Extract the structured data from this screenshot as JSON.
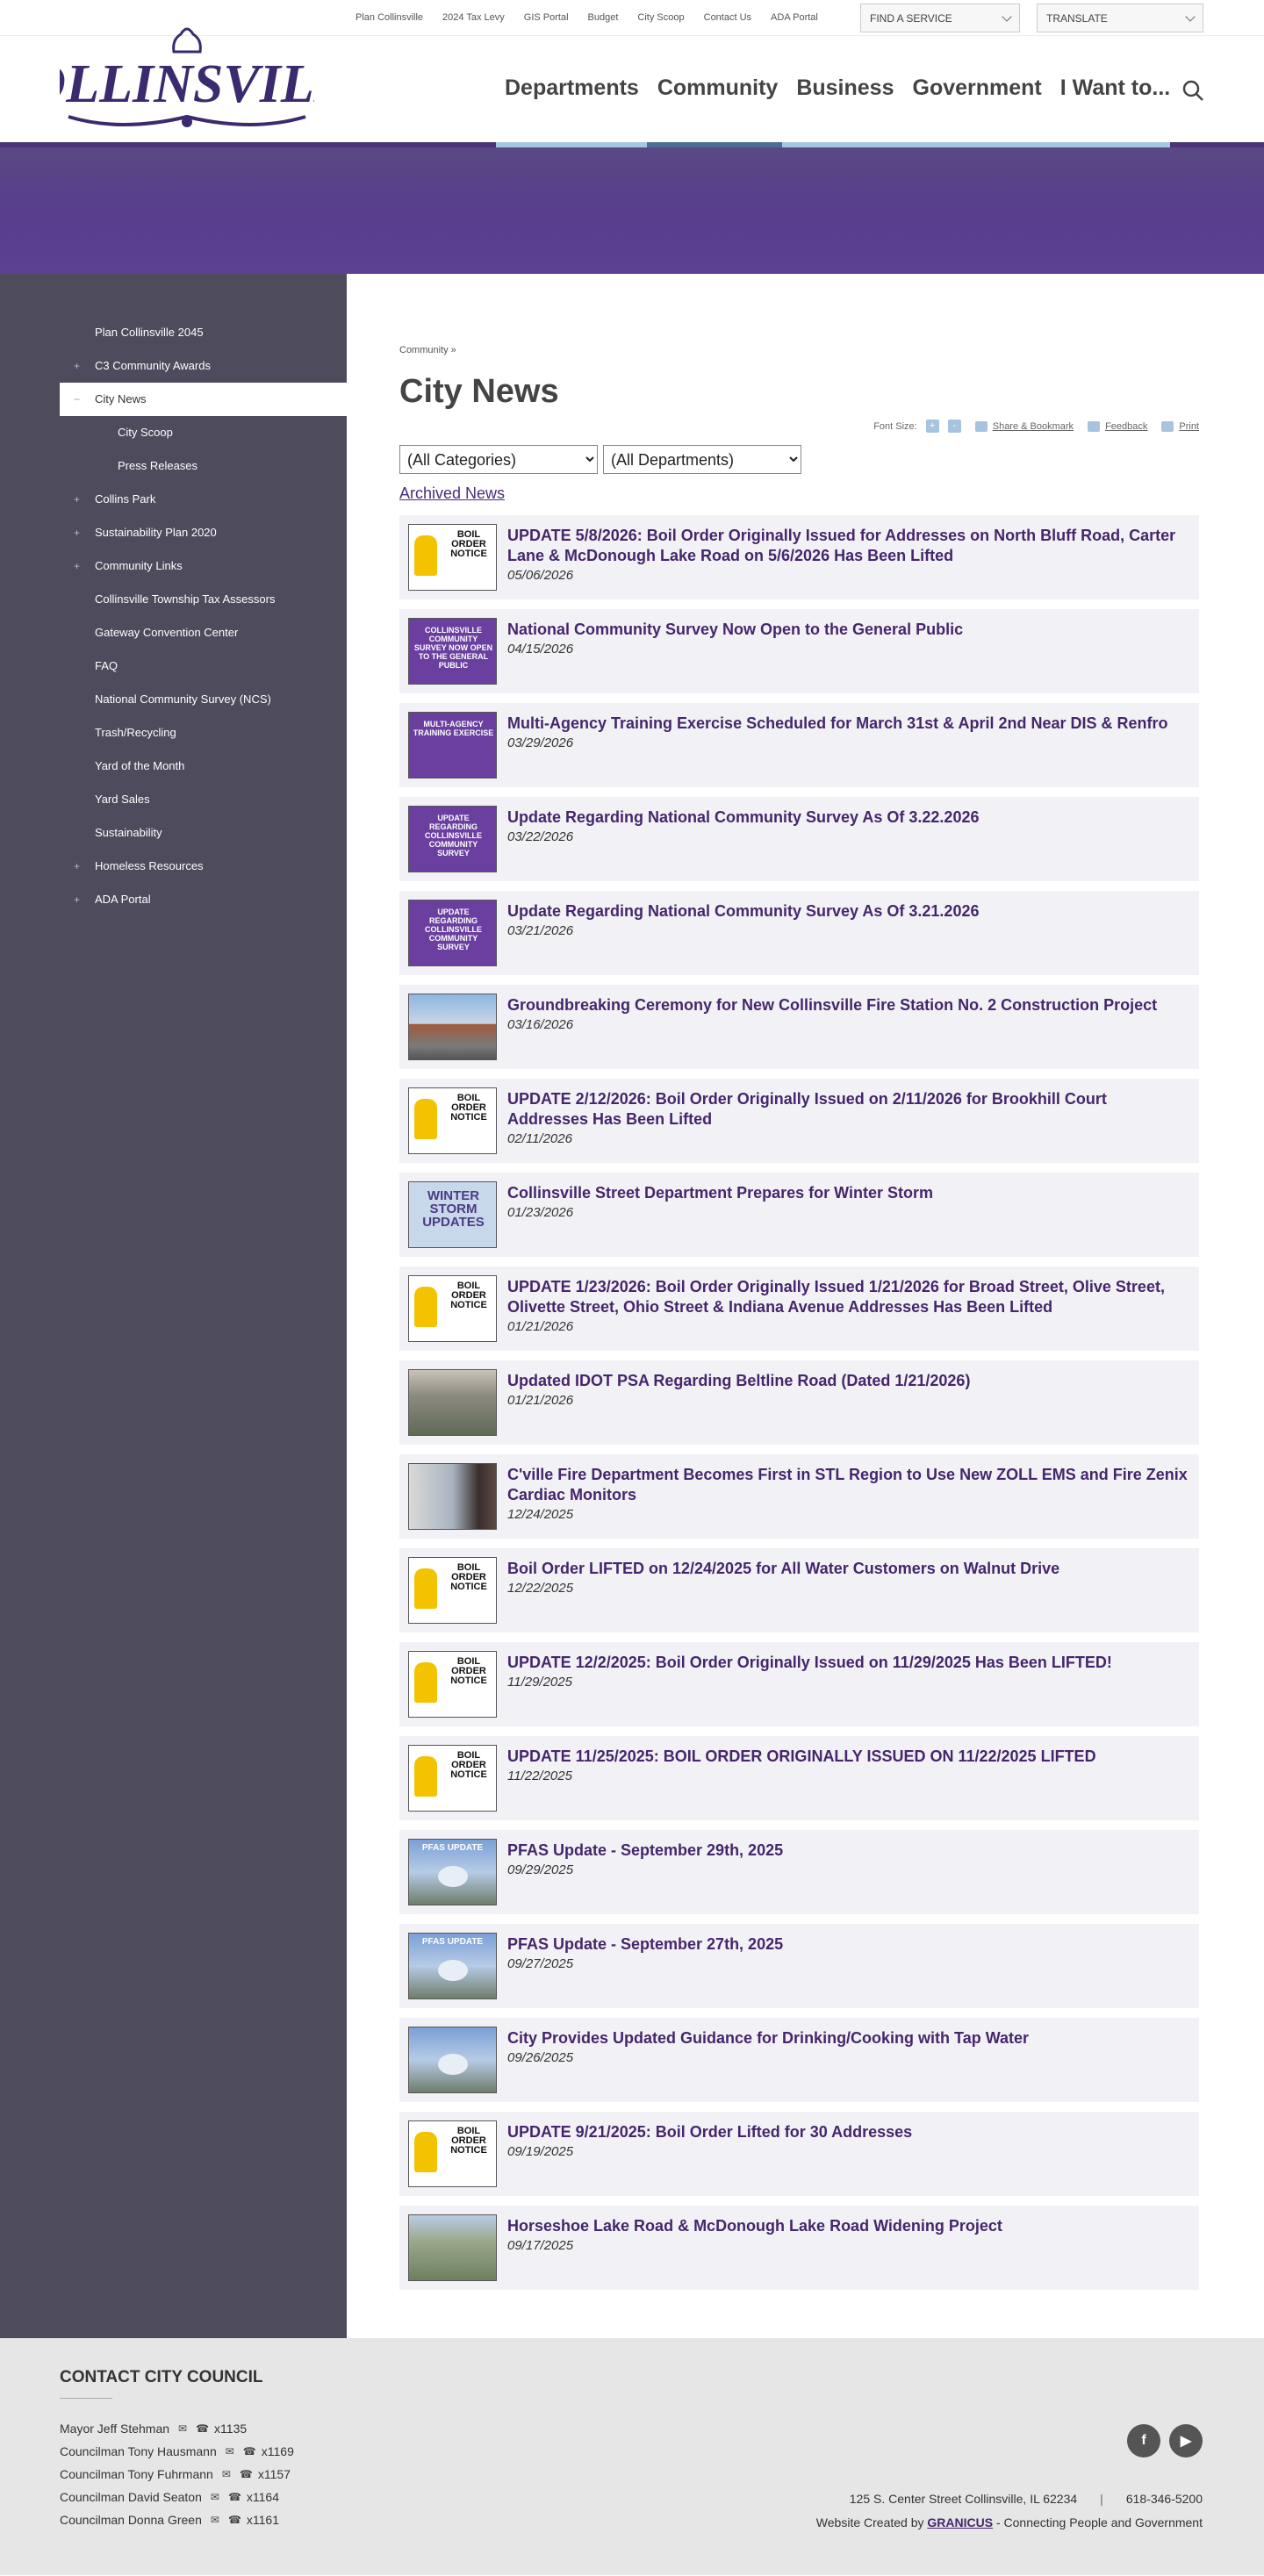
{
  "utility": {
    "links": [
      "Plan Collinsville",
      "2024 Tax Levy",
      "GIS Portal",
      "Budget",
      "City Scoop",
      "Contact Us",
      "ADA Portal"
    ],
    "find_service": "FIND A SERVICE",
    "translate": "TRANSLATE"
  },
  "logo": {
    "text": "COLLINSVILLE"
  },
  "nav": [
    "Departments",
    "Community",
    "Business",
    "Government",
    "I Want to..."
  ],
  "sidebar": [
    {
      "label": "Plan Collinsville 2045",
      "plus": ""
    },
    {
      "label": "C3 Community Awards",
      "plus": "+"
    },
    {
      "label": "City News",
      "plus": "−",
      "active": true
    },
    {
      "label": "City Scoop",
      "plus": "",
      "sub": true
    },
    {
      "label": "Press Releases",
      "plus": "",
      "sub": true
    },
    {
      "label": "Collins Park",
      "plus": "+"
    },
    {
      "label": "Sustainability Plan 2020",
      "plus": "+"
    },
    {
      "label": "Community Links",
      "plus": "+"
    },
    {
      "label": "Collinsville Township Tax Assessors",
      "plus": ""
    },
    {
      "label": "Gateway Convention Center",
      "plus": ""
    },
    {
      "label": "FAQ",
      "plus": ""
    },
    {
      "label": "National Community Survey (NCS)",
      "plus": ""
    },
    {
      "label": "Trash/Recycling",
      "plus": ""
    },
    {
      "label": "Yard of the Month",
      "plus": ""
    },
    {
      "label": "Yard Sales",
      "plus": ""
    },
    {
      "label": "Sustainability",
      "plus": ""
    },
    {
      "label": "Homeless Resources",
      "plus": "+"
    },
    {
      "label": "ADA Portal",
      "plus": "+"
    }
  ],
  "content": {
    "breadcrumb": "Community »",
    "title": "City News",
    "font_size_label": "Font Size:",
    "font_plus": "+",
    "font_minus": "-",
    "share": "Share & Bookmark",
    "feedback": "Feedback",
    "print": "Print",
    "categories": "(All Categories)",
    "departments": "(All Departments)",
    "archived": "Archived News"
  },
  "news": [
    {
      "title": "UPDATE 5/8/2026: Boil Order Originally Issued for Addresses on North Bluff Road, Carter Lane & McDonough Lake Road on 5/6/2026 Has Been Lifted",
      "date": "05/06/2026",
      "thumb": "boil",
      "thumb_text": "BOIL ORDER NOTICE"
    },
    {
      "title": "National Community Survey Now Open to the General Public",
      "date": "04/15/2026",
      "thumb": "purple",
      "thumb_text": "COLLINSVILLE COMMUNITY SURVEY NOW OPEN TO THE GENERAL PUBLIC"
    },
    {
      "title": "Multi-Agency Training Exercise Scheduled for March 31st & April 2nd Near DIS & Renfro",
      "date": "03/29/2026",
      "thumb": "purple",
      "thumb_text": "MULTI-AGENCY TRAINING EXERCISE"
    },
    {
      "title": "Update Regarding National Community Survey As Of 3.22.2026",
      "date": "03/22/2026",
      "thumb": "purple",
      "thumb_text": "UPDATE REGARDING COLLINSVILLE COMMUNITY SURVEY"
    },
    {
      "title": "Update Regarding National Community Survey As Of 3.21.2026",
      "date": "03/21/2026",
      "thumb": "purple",
      "thumb_text": "UPDATE REGARDING COLLINSVILLE COMMUNITY SURVEY"
    },
    {
      "title": "Groundbreaking Ceremony for New Collinsville Fire Station No. 2 Construction Project",
      "date": "03/16/2026",
      "thumb": "photo1",
      "thumb_text": ""
    },
    {
      "title": "UPDATE 2/12/2026: Boil Order Originally Issued on 2/11/2026 for Brookhill Court Addresses Has Been Lifted",
      "date": "02/11/2026",
      "thumb": "boil",
      "thumb_text": "BOIL ORDER NOTICE"
    },
    {
      "title": "Collinsville Street Department Prepares for Winter Storm",
      "date": "01/23/2026",
      "thumb": "winter",
      "thumb_text": "WINTER STORM UPDATES"
    },
    {
      "title": "UPDATE 1/23/2026: Boil Order Originally Issued 1/21/2026 for Broad Street, Olive Street, Olivette Street, Ohio Street & Indiana Avenue Addresses Has Been Lifted",
      "date": "01/21/2026",
      "thumb": "boil",
      "thumb_text": "BOIL ORDER NOTICE"
    },
    {
      "title": "Updated IDOT PSA Regarding Beltline Road (Dated 1/21/2026)",
      "date": "01/21/2026",
      "thumb": "photo2",
      "thumb_text": ""
    },
    {
      "title": "C'ville Fire Department Becomes First in STL Region to Use New ZOLL EMS and Fire Zenix Cardiac Monitors",
      "date": "12/24/2025",
      "thumb": "photo3",
      "thumb_text": ""
    },
    {
      "title": "Boil Order LIFTED on 12/24/2025 for All Water Customers on Walnut Drive",
      "date": "12/22/2025",
      "thumb": "boil",
      "thumb_text": "BOIL ORDER NOTICE"
    },
    {
      "title": "UPDATE 12/2/2025: Boil Order Originally Issued on 11/29/2025 Has Been LIFTED!",
      "date": "11/29/2025",
      "thumb": "boil",
      "thumb_text": "BOIL ORDER NOTICE"
    },
    {
      "title": "UPDATE 11/25/2025: BOIL ORDER ORIGINALLY ISSUED ON 11/22/2025 LIFTED",
      "date": "11/22/2025",
      "thumb": "boil",
      "thumb_text": "BOIL ORDER NOTICE"
    },
    {
      "title": "PFAS Update - September 29th, 2025",
      "date": "09/29/2025",
      "thumb": "pfas",
      "thumb_text": "PFAS UPDATE"
    },
    {
      "title": "PFAS Update - September 27th, 2025",
      "date": "09/27/2025",
      "thumb": "pfas",
      "thumb_text": "PFAS UPDATE"
    },
    {
      "title": "City Provides Updated Guidance for Drinking/Cooking with Tap Water",
      "date": "09/26/2025",
      "thumb": "pfas",
      "thumb_text": ""
    },
    {
      "title": "UPDATE 9/21/2025: Boil Order Lifted for 30 Addresses",
      "date": "09/19/2025",
      "thumb": "boil",
      "thumb_text": "BOIL ORDER NOTICE"
    },
    {
      "title": "Horseshoe Lake Road & McDonough Lake Road Widening Project",
      "date": "09/17/2025",
      "thumb": "road",
      "thumb_text": ""
    }
  ],
  "footer": {
    "heading": "CONTACT CITY COUNCIL",
    "council": [
      {
        "name": "Mayor Jeff Stehman",
        "ext": "x1135"
      },
      {
        "name": "Councilman Tony Hausmann",
        "ext": "x1169"
      },
      {
        "name": "Councilman Tony Fuhrmann",
        "ext": "x1157"
      },
      {
        "name": "Councilman David Seaton",
        "ext": "x1164"
      },
      {
        "name": "Councilman Donna Green",
        "ext": "x1161"
      }
    ],
    "address": "125 S. Center Street Collinsville, IL 62234",
    "phone": "618-346-5200",
    "credit_prefix": "Website Created by",
    "credit_link": "GRANICUS",
    "credit_suffix": "- Connecting People and Government"
  },
  "colors": {
    "brand_purple": "#45266c",
    "banner": "#573d8c",
    "sidebar": "#4d4b5c",
    "accent_blue": "#a6c7e0"
  }
}
